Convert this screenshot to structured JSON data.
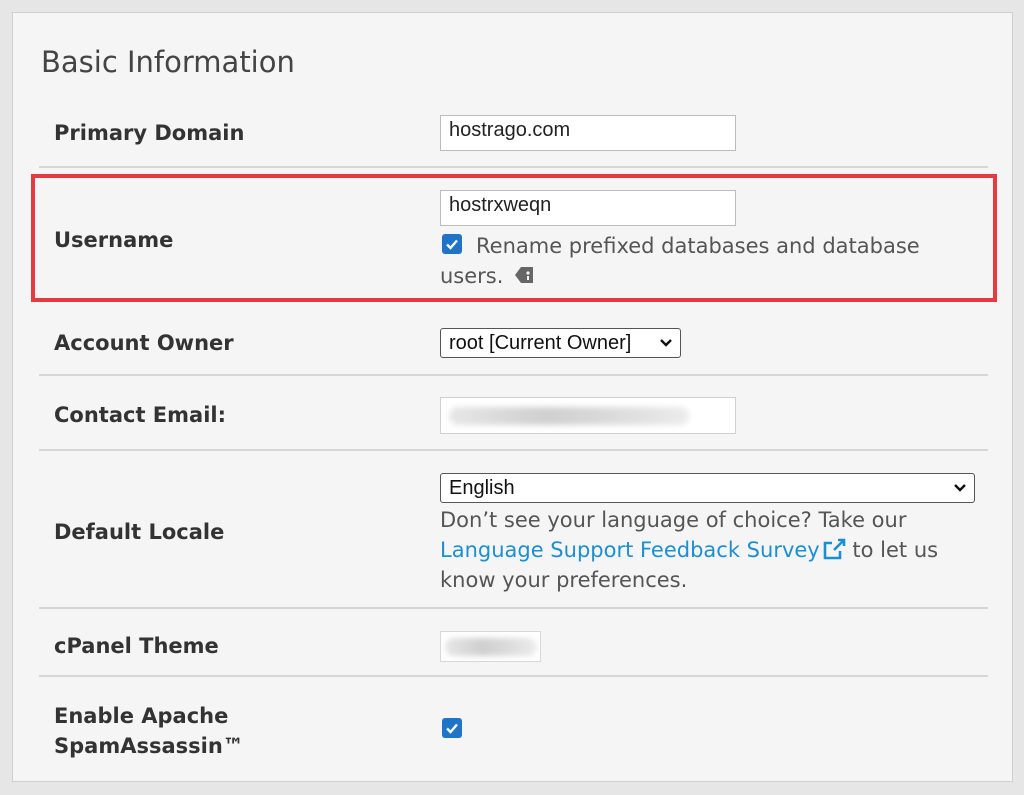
{
  "section": {
    "title": "Basic Information"
  },
  "primary_domain": {
    "label": "Primary Domain",
    "value": "hostrago.com"
  },
  "username": {
    "label": "Username",
    "value": "hostrxweqn",
    "rename_checked": true,
    "rename_text_line1": "Rename prefixed databases and database",
    "rename_text_line2": "users.",
    "info_icon": "tag-icon"
  },
  "account_owner": {
    "label": "Account Owner",
    "selected": "root [Current Owner]"
  },
  "contact_email": {
    "label": "Contact Email:"
  },
  "default_locale": {
    "label": "Default Locale",
    "selected": "English",
    "help_line1": "Don’t see your language of choice? Take our",
    "link_text": "Language Support Feedback Survey",
    "help_after_link": "to let us",
    "help_line3": "know your preferences.",
    "link_icon": "external-link-icon"
  },
  "cpanel_theme": {
    "label": "cPanel Theme"
  },
  "spamassassin": {
    "label_line1": "Enable Apache",
    "label_line2": "SpamAssassin™",
    "checked": true
  },
  "colors": {
    "accent": "#1f74c8",
    "link": "#1c8fd3",
    "highlight": "#e53a40"
  }
}
